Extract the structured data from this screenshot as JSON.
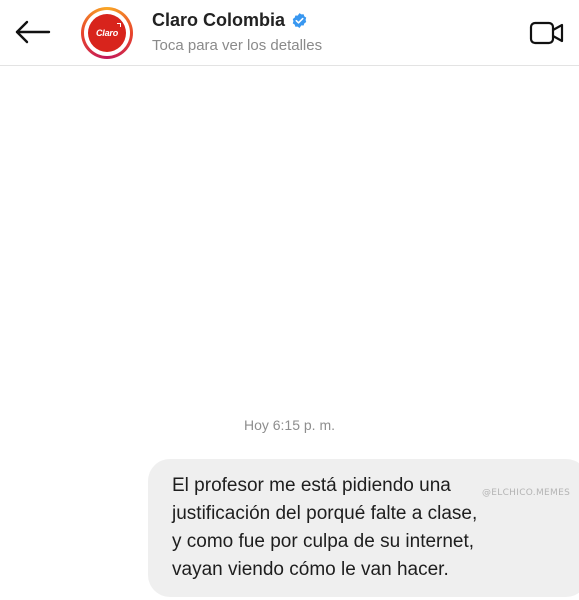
{
  "header": {
    "title": "Claro Colombia",
    "subtitle": "Toca para ver los detalles",
    "avatar_logo_text": "Claro",
    "back_icon": "arrow-left-icon",
    "verified_icon": "verified-badge-icon",
    "video_icon": "video-camera-icon",
    "colors": {
      "brand": "#d8241c",
      "verified": "#3897f0"
    }
  },
  "chat": {
    "timestamp": "Hoy 6:15 p. m.",
    "message_lines": [
      "El profesor me está pidiendo una",
      "justificación del porqué falte a clase,",
      "y como fue por culpa de su internet,",
      "vayan viendo cómo le van hacer."
    ],
    "watermark": "@ELCHICO.MEMES"
  }
}
